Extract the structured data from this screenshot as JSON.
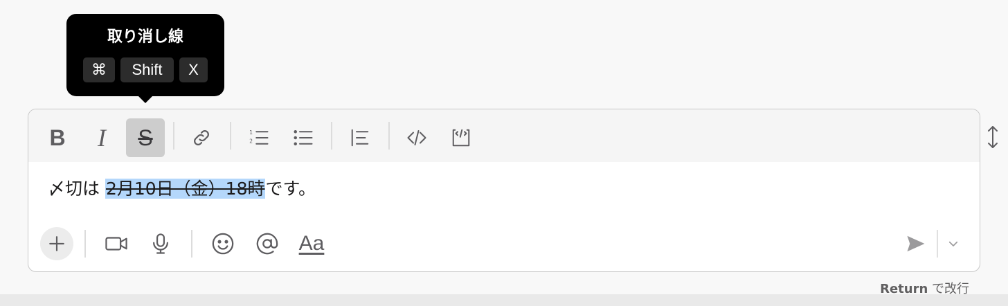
{
  "tooltip": {
    "title": "取り消し線",
    "keys": [
      "⌘",
      "Shift",
      "X"
    ]
  },
  "toolbar": {
    "bold_label": "B",
    "italic_label": "I",
    "strike_label": "S",
    "active_button": "strikethrough",
    "icons": [
      "bold",
      "italic",
      "strikethrough",
      "link-icon",
      "ordered-list-icon",
      "bullet-list-icon",
      "blockquote-icon",
      "code-icon",
      "code-block-icon"
    ]
  },
  "editor": {
    "before": "〆切は ",
    "selected_struck": "2月10日（金）18時",
    "after": "です。"
  },
  "bottom_bar": {
    "icons": [
      "plus-icon",
      "video-icon",
      "microphone-icon",
      "emoji-icon",
      "mention-icon",
      "formatting-icon",
      "send-icon",
      "chevron-down-icon"
    ],
    "format_label": "Aa"
  },
  "hint": {
    "key": "Return",
    "text": " で改行"
  },
  "colors": {
    "tooltip_bg": "#000000",
    "selection": "#b4d7fb",
    "active_button": "#cdcdcd"
  }
}
